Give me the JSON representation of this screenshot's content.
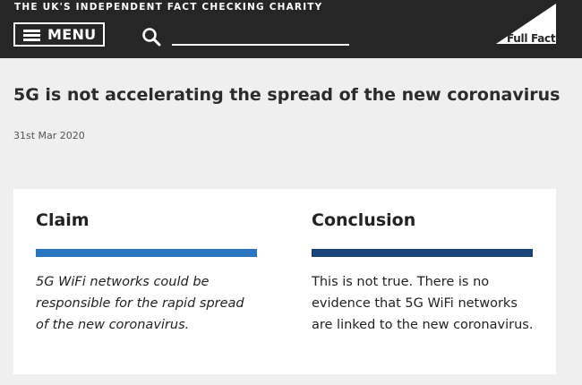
{
  "header": {
    "tagline": "THE UK'S INDEPENDENT FACT CHECKING CHARITY",
    "menu_label": "MENU",
    "search_value": "",
    "logo_text": "Full Fact",
    "background_color": "#262626"
  },
  "article": {
    "title": "5G is not accelerating the spread of the new coronavirus",
    "date": "31st Mar 2020"
  },
  "card": {
    "claim": {
      "heading": "Claim",
      "text": "5G WiFi networks could be responsible for the rapid spread of the new coronavirus.",
      "bar_color": "#2a74c0"
    },
    "conclusion": {
      "heading": "Conclusion",
      "text": "This is not true. There is no evidence that 5G WiFi networks are linked to the new coronavirus.",
      "bar_color": "#1a4378"
    }
  },
  "icons": {
    "menu": "hamburger-icon",
    "search": "search-icon",
    "logo": "full-fact-logo"
  }
}
